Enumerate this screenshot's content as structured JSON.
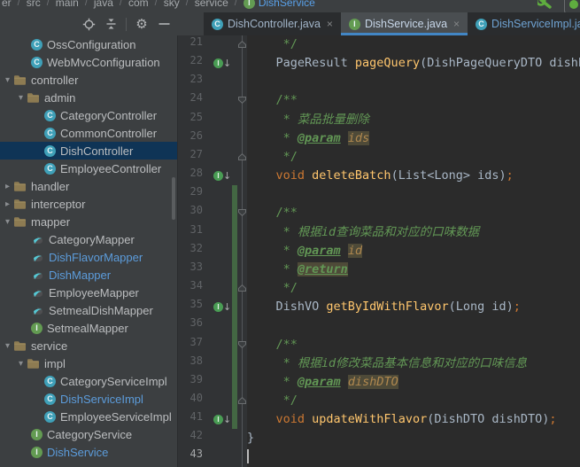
{
  "colors": {
    "accent_underline": "#4286C5",
    "tree_selection": "#0F3456",
    "vcs_added": "#436743",
    "modified_blue": "#5C9CDB",
    "panel": "#3C3F41",
    "editor_bg": "#2B2B2B",
    "gutter_bg": "#313335"
  },
  "breadcrumb": {
    "separator": "/",
    "items": [
      {
        "label": "er"
      },
      {
        "label": "src"
      },
      {
        "label": "main"
      },
      {
        "label": "java"
      },
      {
        "label": "com"
      },
      {
        "label": "sky"
      },
      {
        "label": "service"
      },
      {
        "label": "DishService",
        "icon": "interface-icon",
        "color": "#59A0E8"
      }
    ],
    "right_icons": [
      {
        "name": "wrench-icon",
        "color": "#5FAD3F"
      },
      {
        "name": "partial-toolbar-button"
      }
    ]
  },
  "project_toolbar": {
    "icons": [
      {
        "name": "locate-icon"
      },
      {
        "name": "collapse-all-icon"
      },
      {
        "name": "divider"
      },
      {
        "name": "settings-gear-icon",
        "glyph": "⚙"
      },
      {
        "name": "hide-panel-icon"
      }
    ]
  },
  "tabs": [
    {
      "label": "DishController.java",
      "icon": "class",
      "close": "×",
      "active": false,
      "label_color": "#A2B5C9"
    },
    {
      "label": "DishService.java",
      "icon": "interface",
      "close": "×",
      "active": true,
      "label_color": "#C7D6E8"
    },
    {
      "label": "DishServiceImpl.java",
      "icon": "class",
      "close": "",
      "active": false,
      "label_color": "#6FA3D3"
    }
  ],
  "tree": {
    "items": [
      {
        "label": "OssConfiguration",
        "icon": "class",
        "indent": 35
      },
      {
        "label": "WebMvcConfiguration",
        "icon": "class",
        "indent": 35
      },
      {
        "label": "controller",
        "icon": "folder",
        "chevron": "open",
        "indent": 2
      },
      {
        "label": "admin",
        "icon": "folder",
        "chevron": "open",
        "indent": 17
      },
      {
        "label": "CategoryController",
        "icon": "class",
        "indent": 50
      },
      {
        "label": "CommonController",
        "icon": "class",
        "indent": 50
      },
      {
        "label": "DishController",
        "icon": "class",
        "indent": 50,
        "selected": true
      },
      {
        "label": "EmployeeController",
        "icon": "class",
        "indent": 50
      },
      {
        "label": "handler",
        "icon": "folder",
        "chevron": "closed",
        "indent": 2
      },
      {
        "label": "interceptor",
        "icon": "folder",
        "chevron": "closed",
        "indent": 2
      },
      {
        "label": "mapper",
        "icon": "folder",
        "chevron": "open",
        "indent": 2
      },
      {
        "label": "CategoryMapper",
        "icon": "mapper",
        "indent": 35
      },
      {
        "label": "DishFlavorMapper",
        "icon": "mapper",
        "indent": 35,
        "color": "blue"
      },
      {
        "label": "DishMapper",
        "icon": "mapper",
        "indent": 35,
        "color": "blue"
      },
      {
        "label": "EmployeeMapper",
        "icon": "mapper",
        "indent": 35
      },
      {
        "label": "SetmealDishMapper",
        "icon": "mapper",
        "indent": 35
      },
      {
        "label": "SetmealMapper",
        "icon": "interface",
        "indent": 35
      },
      {
        "label": "service",
        "icon": "folder",
        "chevron": "open",
        "indent": 2
      },
      {
        "label": "impl",
        "icon": "folder",
        "chevron": "open",
        "indent": 17
      },
      {
        "label": "CategoryServiceImpl",
        "icon": "class",
        "indent": 50
      },
      {
        "label": "DishServiceImpl",
        "icon": "class",
        "indent": 50,
        "color": "blue"
      },
      {
        "label": "EmployeeServiceImpl",
        "icon": "class",
        "indent": 50
      },
      {
        "label": "CategoryService",
        "icon": "interface",
        "indent": 35
      },
      {
        "label": "DishService",
        "icon": "interface",
        "indent": 35,
        "color": "blue"
      }
    ]
  },
  "editor": {
    "lines": [
      {
        "num": 21,
        "fold": "end",
        "fline": true,
        "parts": [
          {
            "c": "cmt",
            "t": "     */"
          }
        ]
      },
      {
        "num": 22,
        "gicon": true,
        "fline": true,
        "parts": [
          {
            "c": "pl",
            "t": "    PageResult "
          },
          {
            "c": "fn",
            "t": "pageQuery"
          },
          {
            "c": "pl",
            "t": "(DishPageQueryDTO dishPageQueryDTO);"
          }
        ]
      },
      {
        "num": 23,
        "fline": true,
        "parts": []
      },
      {
        "num": 24,
        "fold": "start",
        "fline": true,
        "parts": [
          {
            "c": "cmt",
            "t": "    /**"
          }
        ]
      },
      {
        "num": 25,
        "fline": true,
        "parts": [
          {
            "c": "cmt",
            "t": "     * "
          },
          {
            "c": "cmtI",
            "t": "菜品批量删除"
          }
        ]
      },
      {
        "num": 26,
        "fline": true,
        "parts": [
          {
            "c": "cmt",
            "t": "     * "
          },
          {
            "c": "tag",
            "t": "@param"
          },
          {
            "c": "cmt",
            "t": " "
          },
          {
            "c": "hl",
            "t": "ids"
          }
        ]
      },
      {
        "num": 27,
        "fold": "end",
        "fline": true,
        "parts": [
          {
            "c": "cmt",
            "t": "     */"
          }
        ]
      },
      {
        "num": 28,
        "gicon": true,
        "fline": true,
        "parts": [
          {
            "c": "kw",
            "t": "    void "
          },
          {
            "c": "fn",
            "t": "deleteBatch"
          },
          {
            "c": "pl",
            "t": "(List<Long> ids)"
          },
          {
            "c": "sc",
            "t": ";"
          }
        ]
      },
      {
        "num": 29,
        "vcs": true,
        "fline": true,
        "parts": []
      },
      {
        "num": 30,
        "vcs": true,
        "fold": "start",
        "fline": true,
        "parts": [
          {
            "c": "cmt",
            "t": "    /**"
          }
        ]
      },
      {
        "num": 31,
        "vcs": true,
        "fline": true,
        "parts": [
          {
            "c": "cmt",
            "t": "     * "
          },
          {
            "c": "cmtI",
            "t": "根据id查询菜品和对应的口味数据"
          }
        ]
      },
      {
        "num": 32,
        "vcs": true,
        "fline": true,
        "parts": [
          {
            "c": "cmt",
            "t": "     * "
          },
          {
            "c": "tag",
            "t": "@param"
          },
          {
            "c": "cmt",
            "t": " "
          },
          {
            "c": "hl",
            "t": "id"
          }
        ]
      },
      {
        "num": 33,
        "vcs": true,
        "fline": true,
        "parts": [
          {
            "c": "cmt",
            "t": "     * "
          },
          {
            "c": "taghl",
            "t": "@return"
          }
        ]
      },
      {
        "num": 34,
        "vcs": true,
        "fold": "end",
        "fline": true,
        "parts": [
          {
            "c": "cmt",
            "t": "     */"
          }
        ]
      },
      {
        "num": 35,
        "vcs": true,
        "gicon": true,
        "fline": true,
        "parts": [
          {
            "c": "pl",
            "t": "    DishVO "
          },
          {
            "c": "fn",
            "t": "getByIdWithFlavor"
          },
          {
            "c": "pl",
            "t": "(Long id)"
          },
          {
            "c": "sc",
            "t": ";"
          }
        ]
      },
      {
        "num": 36,
        "vcs": true,
        "fline": true,
        "parts": []
      },
      {
        "num": 37,
        "vcs": true,
        "fold": "start",
        "fline": true,
        "parts": [
          {
            "c": "cmt",
            "t": "    /**"
          }
        ]
      },
      {
        "num": 38,
        "vcs": true,
        "fline": true,
        "parts": [
          {
            "c": "cmt",
            "t": "     * "
          },
          {
            "c": "cmtI",
            "t": "根据id修改菜品基本信息和对应的口味信息"
          }
        ]
      },
      {
        "num": 39,
        "vcs": true,
        "fline": true,
        "parts": [
          {
            "c": "cmt",
            "t": "     * "
          },
          {
            "c": "tag",
            "t": "@param"
          },
          {
            "c": "cmt",
            "t": " "
          },
          {
            "c": "hl",
            "t": "dishDTO"
          }
        ]
      },
      {
        "num": 40,
        "vcs": true,
        "fold": "end",
        "fline": true,
        "parts": [
          {
            "c": "cmt",
            "t": "     */"
          }
        ]
      },
      {
        "num": 41,
        "vcs": true,
        "gicon": true,
        "fline": true,
        "parts": [
          {
            "c": "kw",
            "t": "    void "
          },
          {
            "c": "fn",
            "t": "updateWithFlavor"
          },
          {
            "c": "pl",
            "t": "(DishDTO dishDTO)"
          },
          {
            "c": "sc",
            "t": ";"
          }
        ]
      },
      {
        "num": 42,
        "fline": true,
        "parts": [
          {
            "c": "pl",
            "t": "}"
          }
        ]
      },
      {
        "num": 43,
        "cur": true,
        "caret": true,
        "fline": true,
        "parts": []
      }
    ]
  }
}
